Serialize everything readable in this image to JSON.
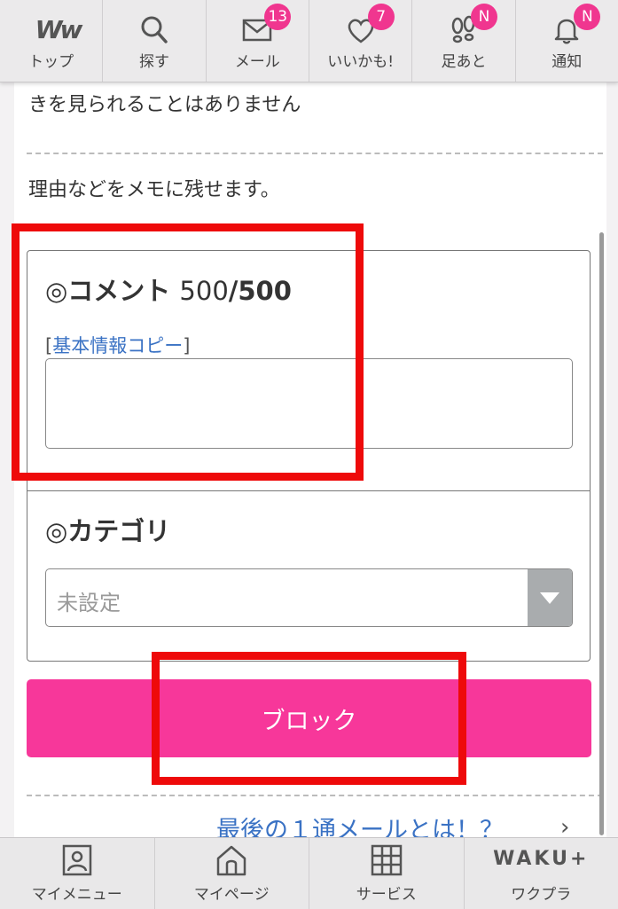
{
  "top_nav": [
    {
      "label": "トップ",
      "icon": "ww-logo-icon",
      "logo_text": "Ww"
    },
    {
      "label": "探す",
      "icon": "search-icon"
    },
    {
      "label": "メール",
      "icon": "mail-icon",
      "badge": "13"
    },
    {
      "label": "いいかも!",
      "icon": "heart-icon",
      "badge": "7"
    },
    {
      "label": "足あと",
      "icon": "footprint-icon",
      "badge": "N"
    },
    {
      "label": "通知",
      "icon": "bell-icon",
      "badge": "N"
    }
  ],
  "content": {
    "intro_tail": "きを見られることはありません",
    "memo_hint": "理由などをメモに残せます。",
    "comment": {
      "header": "◎コメント",
      "count": "500",
      "separator": "/",
      "max": "500",
      "copy_bracket_open": "[",
      "copy_link": "基本情報コピー",
      "copy_bracket_close": "]",
      "value": ""
    },
    "category": {
      "header": "◎カテゴリ",
      "selected": "未設定"
    },
    "block_button": "ブロック",
    "last_mail_link": "最後の１通メールとは！？",
    "chevron": "›"
  },
  "bottom_nav": [
    {
      "label": "マイメニュー",
      "icon": "profile-card-icon"
    },
    {
      "label": "マイページ",
      "icon": "home-icon"
    },
    {
      "label": "サービス",
      "icon": "grid-icon"
    },
    {
      "label": "ワクプラ",
      "icon": "waku-plus-logo",
      "logo_text": "WAKU+"
    }
  ],
  "colors": {
    "accent_pink": "#f7379a",
    "badge_pink": "#f0368f",
    "link_blue": "#3a72c4",
    "highlight_red": "#ee0a0a"
  }
}
